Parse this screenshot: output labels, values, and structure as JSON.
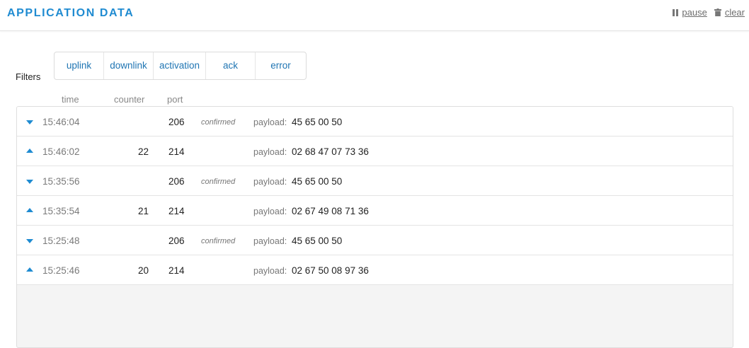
{
  "header": {
    "title": "APPLICATION DATA",
    "pause_label": "pause",
    "clear_label": "clear"
  },
  "filters": {
    "label": "Filters",
    "buttons": [
      "uplink",
      "downlink",
      "activation",
      "ack",
      "error"
    ]
  },
  "columns": {
    "time": "time",
    "counter": "counter",
    "port": "port"
  },
  "colors": {
    "accent": "#1f8bd1",
    "link": "#1f75b3"
  },
  "rows": [
    {
      "direction": "downlink",
      "time": "15:46:04",
      "counter": "",
      "port": "206",
      "confirmed": "confirmed",
      "payload_label": "payload:",
      "payload": "45 65 00 50"
    },
    {
      "direction": "uplink",
      "time": "15:46:02",
      "counter": "22",
      "port": "214",
      "confirmed": "",
      "payload_label": "payload:",
      "payload": "02 68 47 07 73 36"
    },
    {
      "direction": "downlink",
      "time": "15:35:56",
      "counter": "",
      "port": "206",
      "confirmed": "confirmed",
      "payload_label": "payload:",
      "payload": "45 65 00 50"
    },
    {
      "direction": "uplink",
      "time": "15:35:54",
      "counter": "21",
      "port": "214",
      "confirmed": "",
      "payload_label": "payload:",
      "payload": "02 67 49 08 71 36"
    },
    {
      "direction": "downlink",
      "time": "15:25:48",
      "counter": "",
      "port": "206",
      "confirmed": "confirmed",
      "payload_label": "payload:",
      "payload": "45 65 00 50"
    },
    {
      "direction": "uplink",
      "time": "15:25:46",
      "counter": "20",
      "port": "214",
      "confirmed": "",
      "payload_label": "payload:",
      "payload": "02 67 50 08 97 36"
    }
  ]
}
